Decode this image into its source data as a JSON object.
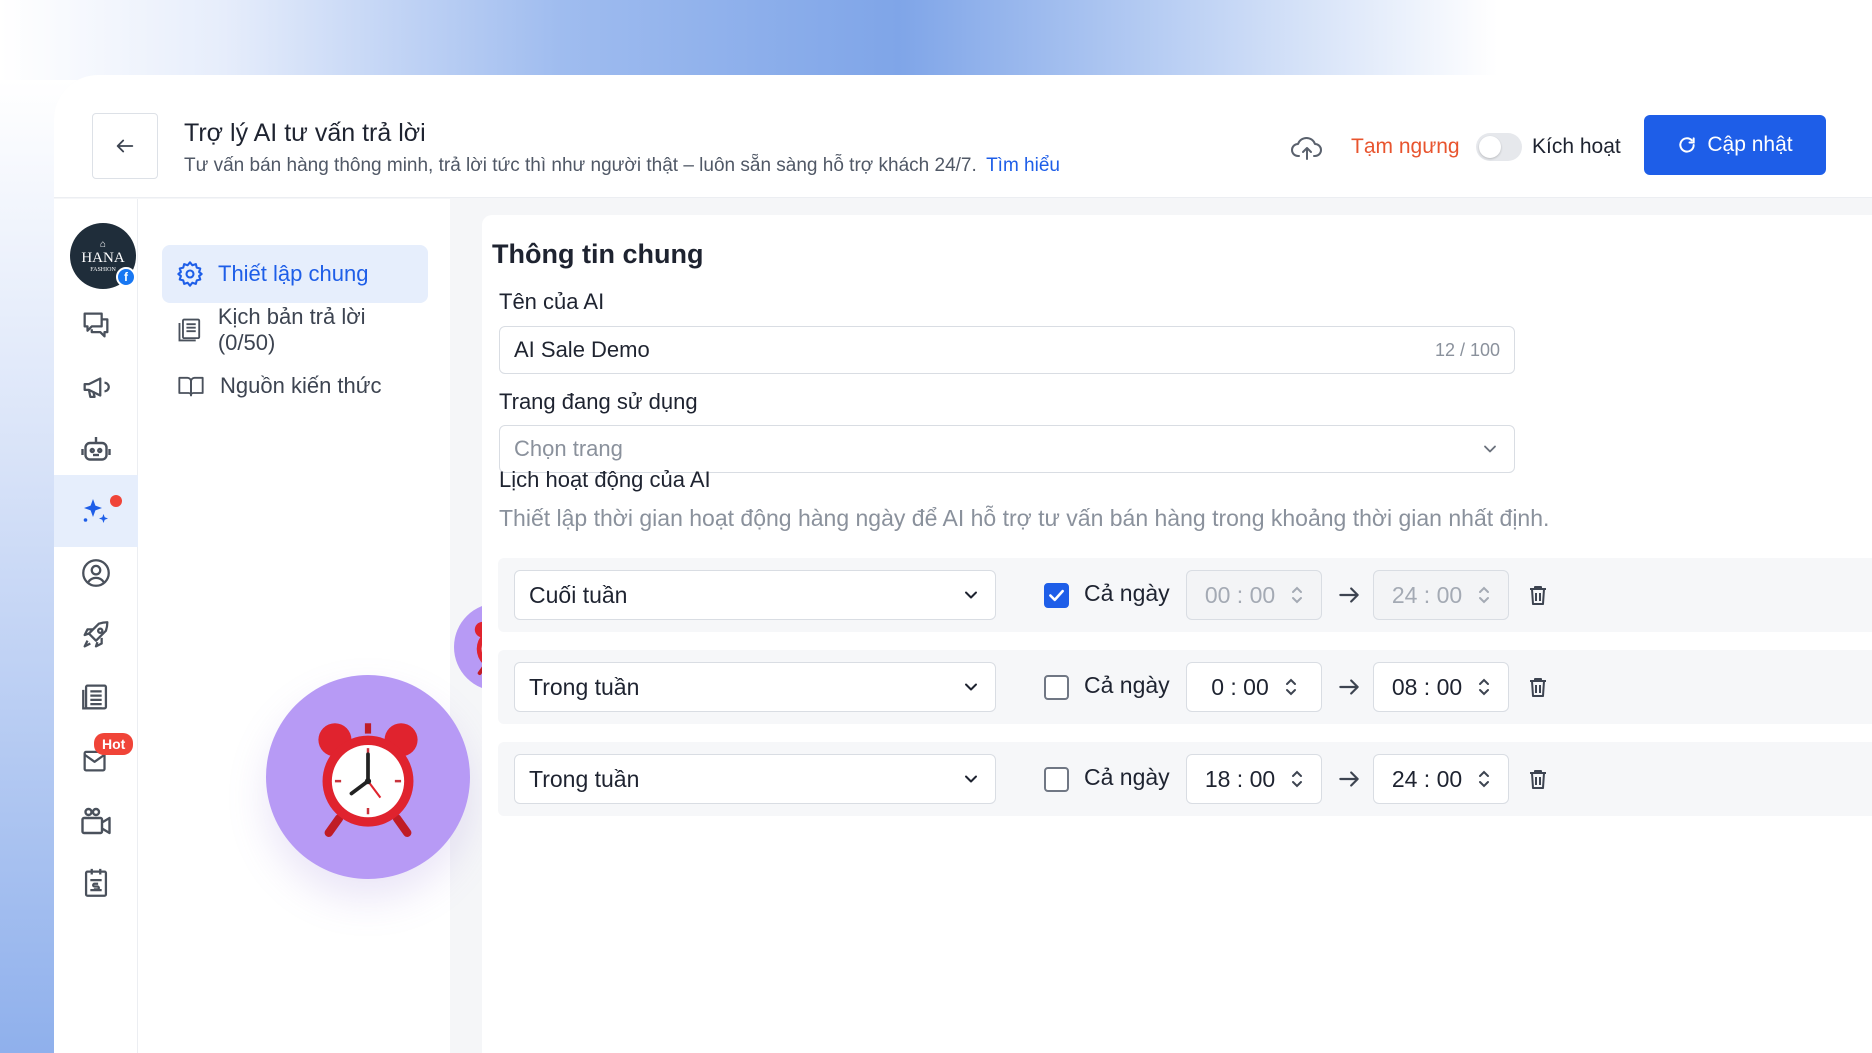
{
  "header": {
    "title": "Trợ lý AI tư vấn trả lời",
    "subtitle": "Tư vấn bán hàng thông minh, trả lời tức thì như người thật – luôn sẵn sàng hỗ trợ khách 24/7.",
    "learn_more": "Tìm hiểu",
    "pause_label": "Tạm ngưng",
    "active_label": "Kích hoạt",
    "update_label": "Cập nhật",
    "toggle_on": false
  },
  "rail": {
    "avatar_text": "HANA",
    "avatar_sub": "FASHION",
    "hot_badge": "Hot"
  },
  "subnav": {
    "items": [
      {
        "label": "Thiết lập chung",
        "icon": "gear-icon",
        "active": true
      },
      {
        "label": "Kịch bản trả lời (0/50)",
        "icon": "script-icon",
        "active": false
      },
      {
        "label": "Nguồn kiến thức",
        "icon": "book-icon",
        "active": false
      }
    ]
  },
  "main": {
    "section_title": "Thông tin chung",
    "ai_name_label": "Tên của AI",
    "ai_name_value": "AI Sale Demo",
    "ai_name_counter": "12 / 100",
    "page_label": "Trang đang sử dụng",
    "page_placeholder": "Chọn trang",
    "schedule_label": "Lịch hoạt động của AI",
    "schedule_desc": "Thiết lập thời gian hoạt động hàng ngày để AI hỗ trợ tư vấn bán hàng trong khoảng thời gian nhất định.",
    "all_day_label": "Cả ngày",
    "schedule_rows": [
      {
        "period": "Cuối tuần",
        "all_day": true,
        "start": "00 : 00",
        "end": "24 : 00"
      },
      {
        "period": "Trong tuần",
        "all_day": false,
        "start": "0 : 00",
        "end": "08 : 00"
      },
      {
        "period": "Trong tuần",
        "all_day": false,
        "start": "18 : 00",
        "end": "24 : 00"
      }
    ]
  },
  "colors": {
    "primary": "#1e5ee8",
    "pause": "#e8542e",
    "accent_purple": "#b79af5"
  }
}
